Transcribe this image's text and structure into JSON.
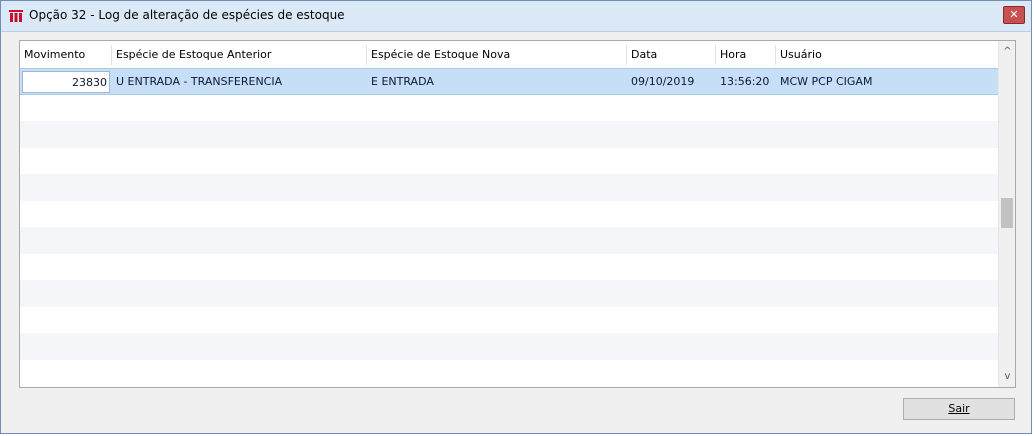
{
  "window": {
    "title": "Opção 32 - Log de alteração de espécies de estoque",
    "close_label": "✕"
  },
  "grid": {
    "columns": [
      "Movimento",
      "Espécie de Estoque Anterior",
      "Espécie de Estoque Nova",
      "Data",
      "Hora",
      "Usuário"
    ],
    "rows": [
      {
        "movimento": "23830",
        "especie_anterior": "U ENTRADA - TRANSFERENCIA",
        "especie_nova": "E ENTRADA",
        "data": "09/10/2019",
        "hora": "13:56:20",
        "usuario": "MCW  PCP CIGAM"
      }
    ],
    "empty_row_count": 11
  },
  "scrollbar": {
    "up_arrow": "^",
    "down_arrow": "v"
  },
  "buttons": {
    "sair_label": "Sair"
  },
  "colors": {
    "selected_row": "#c6dff7",
    "alt_row": "#f4f6fa",
    "title_bar": "#dbe8f6",
    "close_button": "#c75050",
    "app_icon": "#c8102e"
  }
}
